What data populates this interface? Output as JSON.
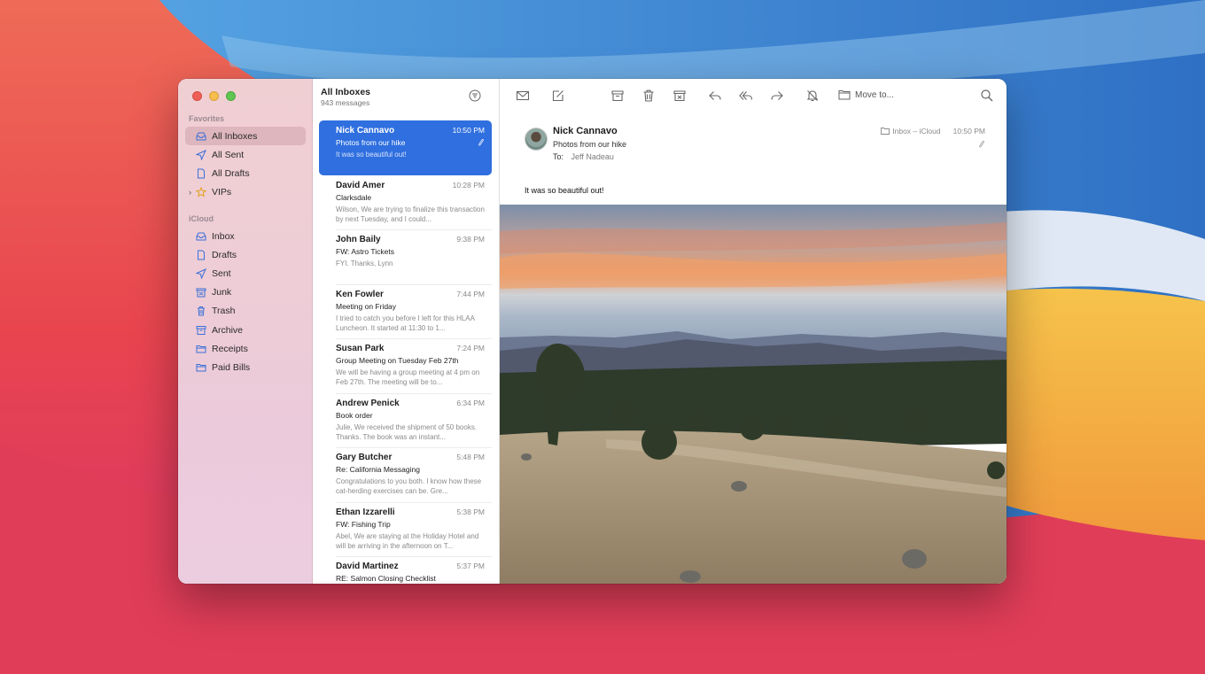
{
  "sidebar": {
    "favorites_label": "Favorites",
    "icloud_label": "iCloud",
    "favorites": [
      {
        "label": "All Inboxes",
        "icon": "inbox-tray-icon"
      },
      {
        "label": "All Sent",
        "icon": "paper-plane-icon"
      },
      {
        "label": "All Drafts",
        "icon": "document-icon"
      },
      {
        "label": "VIPs",
        "icon": "star-icon"
      }
    ],
    "icloud": [
      {
        "label": "Inbox",
        "icon": "inbox-tray-icon"
      },
      {
        "label": "Drafts",
        "icon": "document-icon"
      },
      {
        "label": "Sent",
        "icon": "paper-plane-icon"
      },
      {
        "label": "Junk",
        "icon": "junk-icon"
      },
      {
        "label": "Trash",
        "icon": "trash-icon"
      },
      {
        "label": "Archive",
        "icon": "archive-icon"
      },
      {
        "label": "Receipts",
        "icon": "folder-icon"
      },
      {
        "label": "Paid Bills",
        "icon": "folder-icon"
      }
    ]
  },
  "list": {
    "title": "All Inboxes",
    "count": "943 messages",
    "messages": [
      {
        "sender": "Nick Cannavo",
        "time": "10:50 PM",
        "subject": "Photos from our hike",
        "preview": "It was so beautiful out!"
      },
      {
        "sender": "David Amer",
        "time": "10:28 PM",
        "subject": "Clarksdale",
        "preview": "Wilson, We are trying to finalize this transaction by next Tuesday, and I could..."
      },
      {
        "sender": "John Baily",
        "time": "9:38 PM",
        "subject": "FW: Astro Tickets",
        "preview": "FYI. Thanks, Lynn"
      },
      {
        "sender": "Ken Fowler",
        "time": "7:44 PM",
        "subject": "Meeting on Friday",
        "preview": "I tried to catch you before I left for this HLAA Luncheon. It started at 11:30 to 1..."
      },
      {
        "sender": "Susan Park",
        "time": "7:24 PM",
        "subject": "Group Meeting on Tuesday Feb 27th",
        "preview": "We will be having a group meeting at 4 pm on Feb 27th. The meeting will be to..."
      },
      {
        "sender": "Andrew Penick",
        "time": "6:34 PM",
        "subject": "Book order",
        "preview": "Julie, We received the shipment of 50 books. Thanks. The book was an instant..."
      },
      {
        "sender": "Gary Butcher",
        "time": "5:48 PM",
        "subject": "Re: California Messaging",
        "preview": "Congratulations to you both. I know how these cat-herding exercises can be. Gre..."
      },
      {
        "sender": "Ethan Izzarelli",
        "time": "5:38 PM",
        "subject": "FW: Fishing Trip",
        "preview": "Abel, We are staying at the Holiday Hotel and will be arriving in the afternoon on T..."
      },
      {
        "sender": "David Martinez",
        "time": "5:37 PM",
        "subject": "RE: Salmon Closing Checklist",
        "preview": ""
      }
    ]
  },
  "toolbar": {
    "move_to_label": "Move to..."
  },
  "message": {
    "from": "Nick Cannavo",
    "subject": "Photos from our hike",
    "to_label": "To:",
    "to_name": "Jeff Nadeau",
    "mailbox": "Inbox – iCloud",
    "time": "10:50 PM",
    "body": "It was so beautiful out!"
  },
  "colors": {
    "selection": "#2f6fdf",
    "sidebar_tint": "#eecdd6"
  }
}
